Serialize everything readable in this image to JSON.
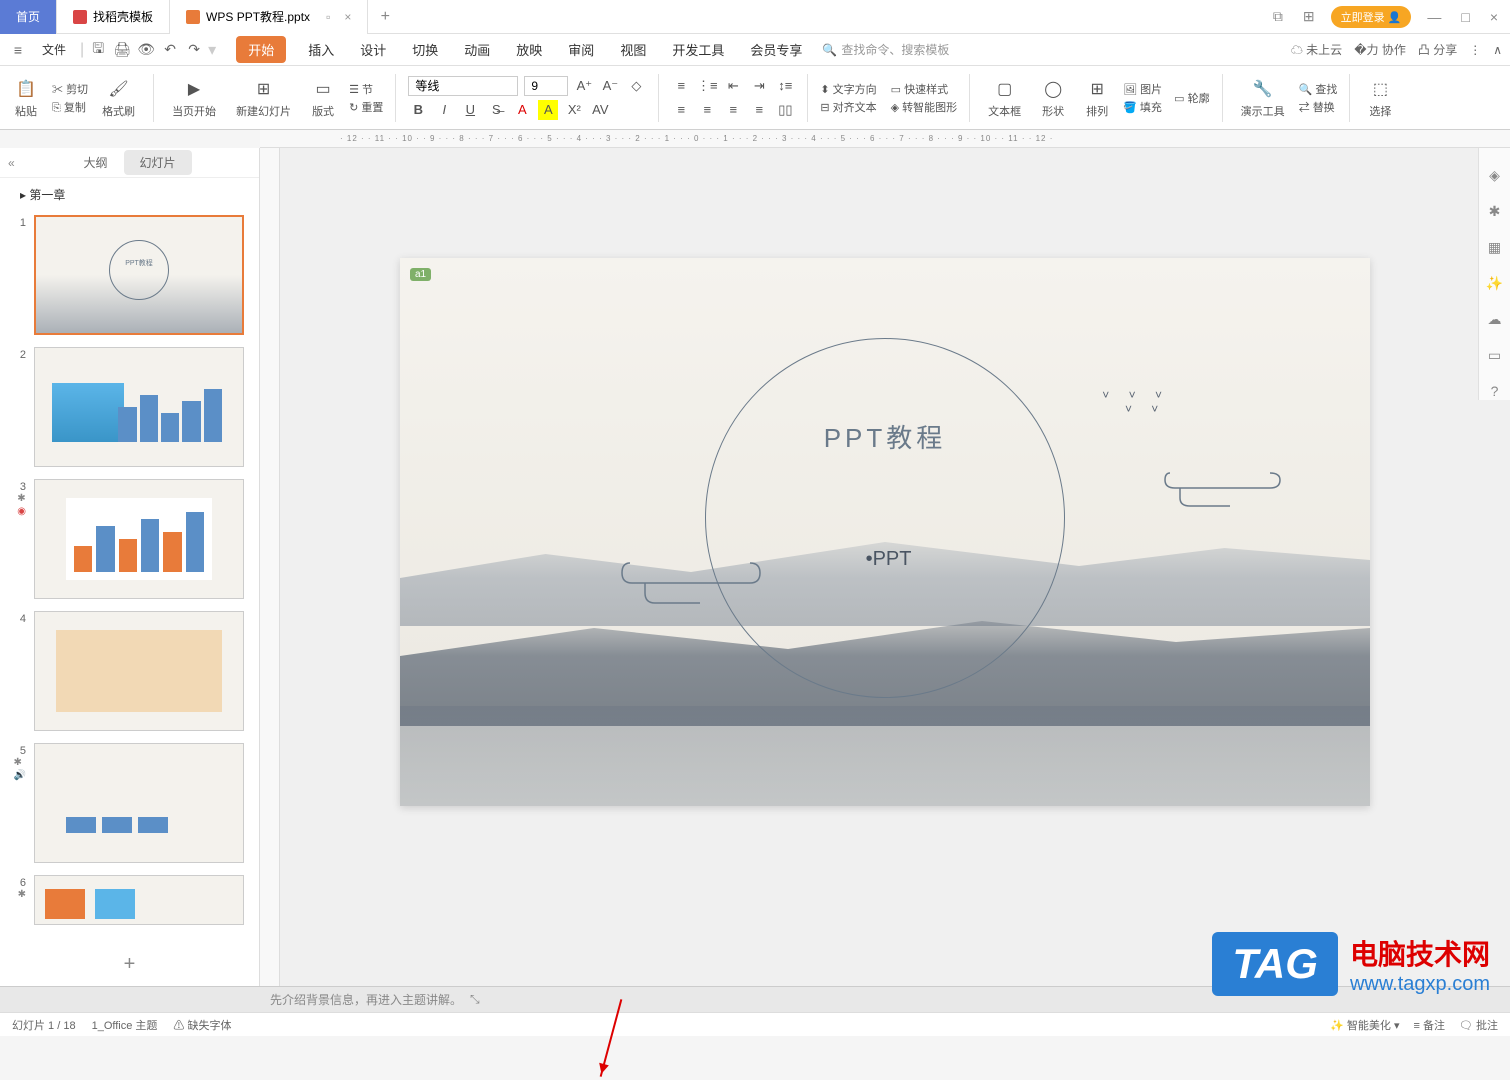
{
  "titleBar": {
    "tabs": [
      {
        "label": "首页",
        "type": "home"
      },
      {
        "label": "找稻壳模板",
        "icon": "red"
      },
      {
        "label": "WPS PPT教程.pptx",
        "icon": "orange",
        "active": true
      }
    ],
    "loginBtn": "立即登录"
  },
  "menuBar": {
    "fileLabel": "文件",
    "ribbonTabs": [
      "开始",
      "插入",
      "设计",
      "切换",
      "动画",
      "放映",
      "审阅",
      "视图",
      "开发工具",
      "会员专享"
    ],
    "activeTab": "开始",
    "searchPlaceholder": "查找命令、搜索模板",
    "right": {
      "cloud": "未上云",
      "coop": "协作",
      "share": "分享"
    }
  },
  "ribbon": {
    "paste": "粘贴",
    "cut": "剪切",
    "copy": "复制",
    "format": "格式刷",
    "startPage": "当页开始",
    "newSlide": "新建幻灯片",
    "layout": "版式",
    "reset": "重置",
    "font": "等线",
    "fontSize": "9",
    "textbox": "文本框",
    "shape": "形状",
    "arrange": "排列",
    "picture": "图片",
    "fill": "填充",
    "outline": "轮廓",
    "tools": "演示工具",
    "find": "查找",
    "replace": "替换",
    "select": "选择",
    "alignText": "对齐文本",
    "convertShape": "转智能图形"
  },
  "sidePanel": {
    "tabs": [
      "大纲",
      "幻灯片"
    ],
    "activeTab": "幻灯片",
    "chapter": "第一章",
    "slideCount": 6
  },
  "slide": {
    "tag": "a1",
    "title": "PPT教程",
    "subtitle": "•PPT"
  },
  "notes": {
    "text": "先介绍背景信息，再进入主题讲解。"
  },
  "statusBar": {
    "slideInfo": "幻灯片 1 / 18",
    "theme": "1_Office 主题",
    "missingFont": "缺失字体",
    "beautify": "智能美化",
    "notes": "备注",
    "comments": "批注"
  },
  "watermark": {
    "tag": "TAG",
    "text": "电脑技术网",
    "url": "www.tagxp.com"
  },
  "rulerH": "· 12 · · 11 · · 10 · · 9 · · · 8 · · · 7 · · · 6 · · · 5 · · · 4 · · · 3 · · · 2 · · · 1 · · · 0 · · · 1 · · · 2 · · · 3 · · · 4 · · · 5 · · · 6 · · · 7 · · · 8 · · · 9 · · 10 · · 11 · · 12 ·"
}
